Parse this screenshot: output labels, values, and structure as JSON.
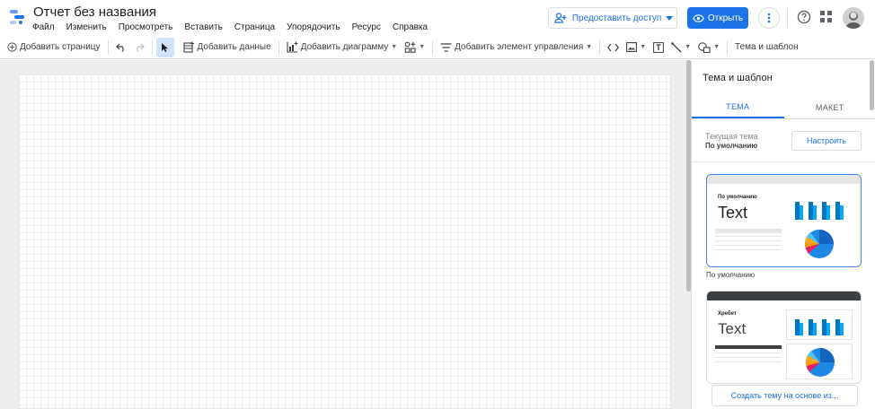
{
  "header": {
    "title": "Отчет без названия",
    "menu": [
      "Файл",
      "Изменить",
      "Просмотреть",
      "Вставить",
      "Страница",
      "Упорядочить",
      "Ресурс",
      "Справка"
    ],
    "share_label": "Предоставить доступ",
    "open_label": "Открыть"
  },
  "toolbar": {
    "add_page": "Добавить страницу",
    "add_data": "Добавить данные",
    "add_chart": "Добавить диаграмму",
    "add_control": "Добавить элемент управления",
    "theme_layout": "Тема и шаблон"
  },
  "panel": {
    "title": "Тема и шаблон",
    "tabs": [
      {
        "label": "ТЕМА",
        "active": true
      },
      {
        "label": "МАКЕТ",
        "active": false
      }
    ],
    "current_theme_label": "Текущая тема",
    "current_theme_value": "По умолчанию",
    "customize_label": "Настроить",
    "themes": [
      {
        "name": "По умолчанию",
        "preview_small": "По умолчанию",
        "preview_big": "Text"
      },
      {
        "name": "Хребет",
        "preview_small": "Хребет",
        "preview_big": "Text"
      }
    ],
    "create_theme_label": "Создать тему на основе из..."
  },
  "colors": {
    "accent": "#1a73e8",
    "bar_dark": "#0277bd",
    "bar_light": "#03a9f4",
    "spine_header": "#3c4043"
  }
}
